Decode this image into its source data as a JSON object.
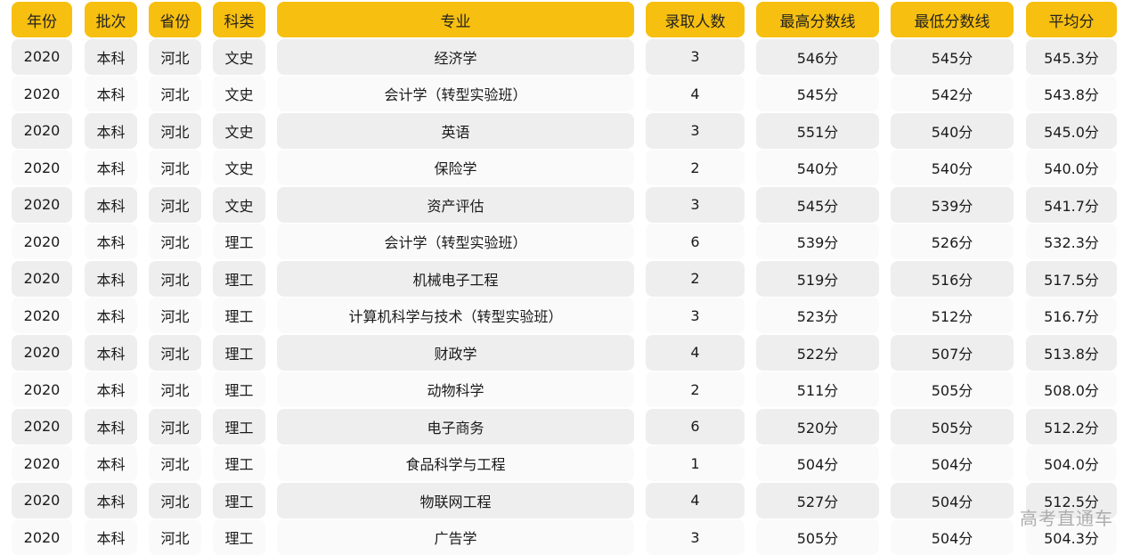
{
  "table": {
    "headers": [
      "年份",
      "批次",
      "省份",
      "科类",
      "专业",
      "录取人数",
      "最高分数线",
      "最低分数线",
      "平均分"
    ],
    "rows": [
      [
        "2020",
        "本科",
        "河北",
        "文史",
        "经济学",
        "3",
        "546分",
        "545分",
        "545.3分"
      ],
      [
        "2020",
        "本科",
        "河北",
        "文史",
        "会计学（转型实验班）",
        "4",
        "545分",
        "542分",
        "543.8分"
      ],
      [
        "2020",
        "本科",
        "河北",
        "文史",
        "英语",
        "3",
        "551分",
        "540分",
        "545.0分"
      ],
      [
        "2020",
        "本科",
        "河北",
        "文史",
        "保险学",
        "2",
        "540分",
        "540分",
        "540.0分"
      ],
      [
        "2020",
        "本科",
        "河北",
        "文史",
        "资产评估",
        "3",
        "545分",
        "539分",
        "541.7分"
      ],
      [
        "2020",
        "本科",
        "河北",
        "理工",
        "会计学（转型实验班）",
        "6",
        "539分",
        "526分",
        "532.3分"
      ],
      [
        "2020",
        "本科",
        "河北",
        "理工",
        "机械电子工程",
        "2",
        "519分",
        "516分",
        "517.5分"
      ],
      [
        "2020",
        "本科",
        "河北",
        "理工",
        "计算机科学与技术（转型实验班）",
        "3",
        "523分",
        "512分",
        "516.7分"
      ],
      [
        "2020",
        "本科",
        "河北",
        "理工",
        "财政学",
        "4",
        "522分",
        "507分",
        "513.8分"
      ],
      [
        "2020",
        "本科",
        "河北",
        "理工",
        "动物科学",
        "2",
        "511分",
        "505分",
        "508.0分"
      ],
      [
        "2020",
        "本科",
        "河北",
        "理工",
        "电子商务",
        "6",
        "520分",
        "505分",
        "512.2分"
      ],
      [
        "2020",
        "本科",
        "河北",
        "理工",
        "食品科学与工程",
        "1",
        "504分",
        "504分",
        "504.0分"
      ],
      [
        "2020",
        "本科",
        "河北",
        "理工",
        "物联网工程",
        "4",
        "527分",
        "504分",
        "512.5分"
      ],
      [
        "2020",
        "本科",
        "河北",
        "理工",
        "广告学",
        "3",
        "505分",
        "504分",
        "504.3分"
      ]
    ]
  },
  "watermark": "高考直通车",
  "colors": {
    "header": "#f7bf0f",
    "row_odd": "#eeeeee",
    "row_even": "#fafafa"
  }
}
